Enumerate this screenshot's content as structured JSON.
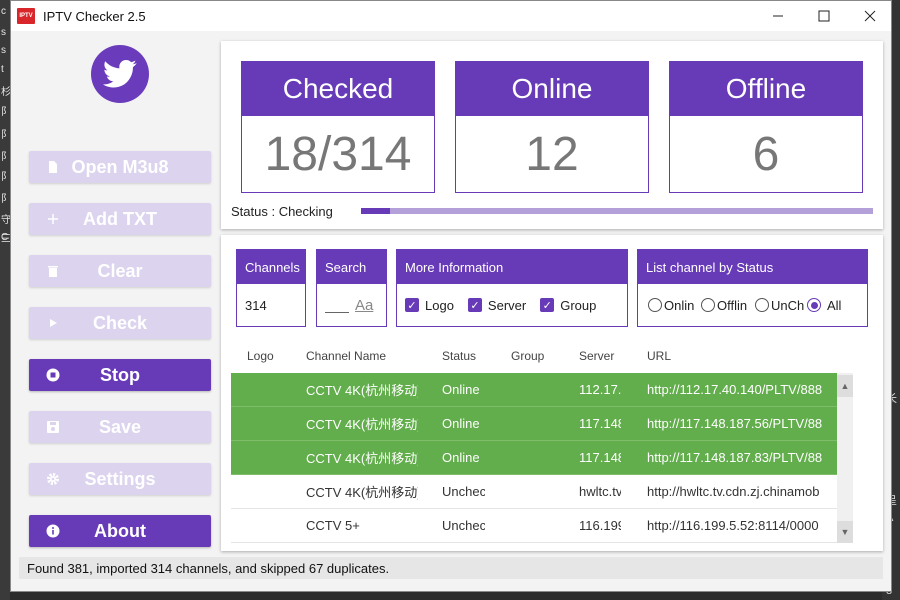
{
  "window": {
    "app_icon_text": "IPTV",
    "title": "IPTV Checker 2.5"
  },
  "desktop_left_chars": [
    "c",
    "s",
    "s",
    "t",
    "杉",
    "阝",
    "阝",
    "阝",
    "阝",
    "阝",
    "守",
    "三",
    "C"
  ],
  "desktop_right_chars": [
    "长",
    "8",
    "8",
    "8",
    "8",
    "呈",
    "A",
    "8",
    "8",
    "8",
    "8"
  ],
  "sidebar": {
    "avatar_icon": "twitter-bird-icon",
    "buttons": [
      {
        "label": "Open M3u8",
        "icon": "file-icon",
        "state": "disabled"
      },
      {
        "label": "Add TXT",
        "icon": "plus-icon",
        "state": "disabled"
      },
      {
        "label": "Clear",
        "icon": "trash-icon",
        "state": "disabled"
      },
      {
        "label": "Check",
        "icon": "play-icon",
        "state": "disabled"
      },
      {
        "label": "Stop",
        "icon": "stop-icon",
        "state": "active"
      },
      {
        "label": "Save",
        "icon": "save-icon",
        "state": "disabled"
      },
      {
        "label": "Settings",
        "icon": "gear-icon",
        "state": "disabled"
      },
      {
        "label": "About",
        "icon": "info-icon",
        "state": "active"
      }
    ]
  },
  "stats": {
    "checked_label": "Checked",
    "checked_value": "18/314",
    "online_label": "Online",
    "online_value": "12",
    "offline_label": "Offline",
    "offline_value": "6"
  },
  "status": {
    "text": "Status : Checking",
    "progress": 0.057
  },
  "filters": {
    "channels_label": "Channels",
    "channels_value": "314",
    "search_label": "Search",
    "search_value": "",
    "search_icon_text": "Aa",
    "more_info_label": "More Information",
    "more_info_options": [
      {
        "label": "Logo",
        "checked": true
      },
      {
        "label": "Server",
        "checked": true
      },
      {
        "label": "Group",
        "checked": true
      }
    ],
    "list_status_label": "List channel by Status",
    "status_options": [
      {
        "label": "Onlin",
        "selected": false
      },
      {
        "label": "Offlin",
        "selected": false
      },
      {
        "label": "UnCh",
        "selected": false
      },
      {
        "label": "All",
        "selected": true
      }
    ]
  },
  "table": {
    "columns": [
      "Logo",
      "Channel Name",
      "Status",
      "Group",
      "Server",
      "URL"
    ],
    "rows": [
      {
        "logo": "",
        "channel": "CCTV 4K(杭州移动)",
        "status": "Online",
        "group": "",
        "server": "112.17.",
        "url": "http://112.17.40.140/PLTV/888",
        "online": true
      },
      {
        "logo": "",
        "channel": "CCTV 4K(杭州移动)",
        "status": "Online",
        "group": "",
        "server": "117.148",
        "url": "http://117.148.187.56/PLTV/88",
        "online": true
      },
      {
        "logo": "",
        "channel": "CCTV 4K(杭州移动)",
        "status": "Online",
        "group": "",
        "server": "117.148",
        "url": "http://117.148.187.83/PLTV/88",
        "online": true
      },
      {
        "logo": "",
        "channel": "CCTV 4K(杭州移动)",
        "status": "Unchec",
        "group": "",
        "server": "hwltc.tv",
        "url": "http://hwltc.tv.cdn.zj.chinamob",
        "online": false
      },
      {
        "logo": "",
        "channel": "CCTV 5+",
        "status": "Unchec",
        "group": "",
        "server": "116.199",
        "url": "http://116.199.5.52:8114/0000",
        "online": false
      }
    ]
  },
  "statusbar": {
    "text": "Found 381, imported 314 channels, and skipped 67 duplicates."
  },
  "colors": {
    "accent": "#673ab7",
    "accent_disabled": "#dcd3ee",
    "online_row": "#62ad4c"
  }
}
